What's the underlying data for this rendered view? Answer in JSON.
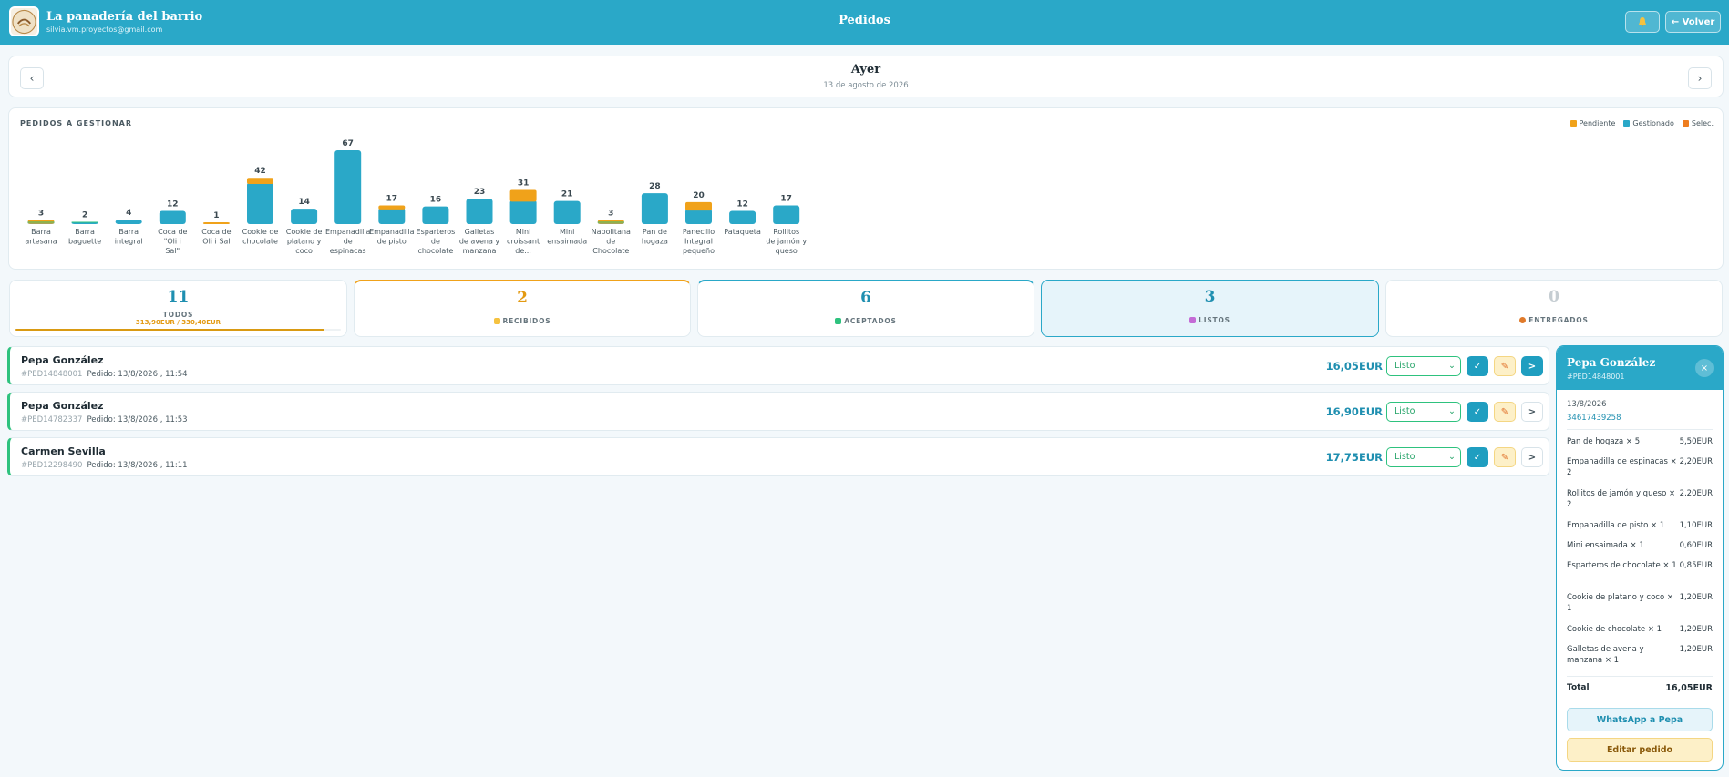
{
  "header": {
    "shop_name": "La panadería del barrio",
    "shop_email": "silvia.vm.proyectos@gmail.com",
    "title": "Pedidos",
    "bell_icon": "bell-icon",
    "back_label": "← Volver"
  },
  "datebar": {
    "prev": "‹",
    "next": "›",
    "title": "Ayer",
    "subtitle": "13 de agosto de 2026"
  },
  "chart_section": {
    "title": "PEDIDOS A GESTIONAR",
    "legend": [
      {
        "label": "Pendiente",
        "color": "#f0a21a"
      },
      {
        "label": "Gestionado",
        "color": "#2aa8c8"
      },
      {
        "label": "Selec.",
        "color": "#ee7d1f"
      }
    ]
  },
  "chart_data": {
    "type": "bar",
    "stacked": true,
    "categories": [
      "Barra artesana",
      "Barra baguette",
      "Barra integral",
      "Coca de \"Oli i Sal\"",
      "Coca de Oli i Sal",
      "Cookie de chocolate",
      "Cookie de platano y coco",
      "Empanadilla de espinacas",
      "Empanadilla de pisto",
      "Esparteros de chocolate",
      "Galletas de avena y manzana",
      "Mini croissant de...",
      "Mini ensaimada",
      "Napolitana de Chocolate",
      "Pan de hogaza",
      "Panecillo Integral pequeño",
      "Pataqueta",
      "Rollitos de jamón y queso"
    ],
    "totals": [
      3,
      2,
      4,
      12,
      1,
      42,
      14,
      67,
      17,
      16,
      23,
      31,
      21,
      3,
      28,
      20,
      12,
      17
    ],
    "series": [
      {
        "name": "Gestionado",
        "values": [
          2,
          2,
          4,
          12,
          0,
          38,
          14,
          67,
          15,
          16,
          23,
          22,
          21,
          2,
          28,
          14,
          12,
          17
        ]
      },
      {
        "name": "Pendiente",
        "values": [
          1,
          0,
          0,
          0,
          1,
          4,
          0,
          0,
          2,
          0,
          0,
          9,
          0,
          1,
          0,
          6,
          0,
          0
        ]
      }
    ],
    "ylim": [
      0,
      67
    ],
    "legend": "top-right"
  },
  "status_cards": {
    "todos": {
      "count": "11",
      "label": "TODOS",
      "amount": "313,90EUR / 330,40EUR",
      "progress": 0.95
    },
    "recibidos": {
      "count": "2",
      "label": "RECIBIDOS",
      "icon": "bell-icon"
    },
    "aceptados": {
      "count": "6",
      "label": "ACEPTADOS",
      "icon": "check-icon"
    },
    "listos": {
      "count": "3",
      "label": "LISTOS",
      "icon": "party-icon"
    },
    "entregados": {
      "count": "0",
      "label": "ENTREGADOS",
      "icon": "box-icon"
    }
  },
  "orders": [
    {
      "name": "Pepa González",
      "id": "#PED14848001",
      "meta": "Pedido: 13/8/2026 , 11:54",
      "price": "16,05EUR",
      "status": "Listo"
    },
    {
      "name": "Pepa González",
      "id": "#PED14782337",
      "meta": "Pedido: 13/8/2026 , 11:53",
      "price": "16,90EUR",
      "status": "Listo"
    },
    {
      "name": "Carmen Sevilla",
      "id": "#PED12298490",
      "meta": "Pedido: 13/8/2026 , 11:11",
      "price": "17,75EUR",
      "status": "Listo"
    }
  ],
  "row_buttons": {
    "check": "✓",
    "edit": "✎",
    "go": ">",
    "chevron": "⌄"
  },
  "detail": {
    "name": "Pepa González",
    "id": "#PED14848001",
    "close": "×",
    "date": "13/8/2026",
    "phone": "34617439258",
    "items": [
      {
        "name": "Pan de hogaza × 5",
        "price": "5,50EUR"
      },
      {
        "name": "Empanadilla de espinacas × 2",
        "price": "2,20EUR"
      },
      {
        "name": "Rollitos de jamón y queso × 2",
        "price": "2,20EUR"
      },
      {
        "name": "Empanadilla de pisto × 1",
        "price": "1,10EUR"
      },
      {
        "name": "Mini ensaimada × 1",
        "price": "0,60EUR"
      },
      {
        "name": "Esparteros de chocolate × 1",
        "price": "0,85EUR"
      },
      {
        "name": "Cookie de platano y coco × 1",
        "price": "1,20EUR"
      },
      {
        "name": "Cookie de chocolate × 1",
        "price": "1,20EUR"
      },
      {
        "name": "Galletas de avena y manzana × 1",
        "price": "1,20EUR"
      }
    ],
    "total_label": "Total",
    "total_value": "16,05EUR",
    "whatsapp_label": "WhatsApp a Pepa",
    "edit_label": "Editar pedido"
  }
}
